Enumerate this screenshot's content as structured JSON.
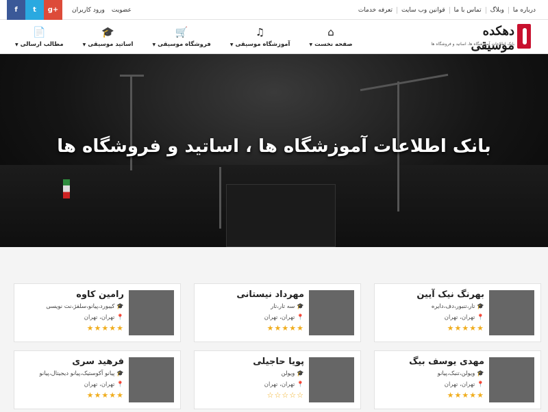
{
  "topbar": {
    "links": [
      "درباره ما",
      "وبلاگ",
      "تماس با ما",
      "قوانین وب سایت",
      "تعرفه خدمات"
    ],
    "membership": "عضویت",
    "login": "ورود کاربران",
    "social": [
      "g+",
      "t",
      "f"
    ]
  },
  "logo": {
    "name": "دهکده موسیقی",
    "subtitle": "بانک اطلاعات آموزشگاه ها، اساتید و فروشگاه ها"
  },
  "menu": [
    {
      "label": "مطالب ارسالی",
      "icon": "document-icon",
      "glyph": "📄"
    },
    {
      "label": "اساتید موسیقی",
      "icon": "graduation-cap-icon",
      "glyph": "🎓"
    },
    {
      "label": "فروشگاه موسیقی",
      "icon": "cart-icon",
      "glyph": "🛒"
    },
    {
      "label": "آموزشگاه موسیقی",
      "icon": "music-note-icon",
      "glyph": "♫"
    },
    {
      "label": "صفحه نخست",
      "icon": "home-icon",
      "glyph": "⌂"
    }
  ],
  "hero": {
    "title": "بانک اطلاعات آموزشگاه ها ، اساتید و فروشگاه ها"
  },
  "cards": [
    {
      "name": "بهرنگ نیک آیین",
      "skills": "تار،تنبور،دف،دایره",
      "location": "تهران، تهران",
      "rating": 5
    },
    {
      "name": "مهرداد نیستانی",
      "skills": "سه تار،تار",
      "location": "تهران، تهران",
      "rating": 5
    },
    {
      "name": "رامین کاوه",
      "skills": "کیبورد،پیانو،سلفژ،نت نویسی",
      "location": "تهران، تهران",
      "rating": 5
    },
    {
      "name": "مهدی یوسف بیگ",
      "skills": "ویولن،تنبک،پیانو",
      "location": "تهران، تهران",
      "rating": 5
    },
    {
      "name": "پویا حاجیلی",
      "skills": "ویولن",
      "location": "تهران، تهران",
      "rating": 0
    },
    {
      "name": "فرهید سری",
      "skills": "پیانو آکوستیک،پیانو دیجیتال،پیانو",
      "location": "تهران، تهران",
      "rating": 5
    }
  ],
  "colors": {
    "star": "#f0ad1e",
    "facebook": "#3b5998",
    "twitter": "#2aa9e0",
    "google": "#dd4b39"
  }
}
